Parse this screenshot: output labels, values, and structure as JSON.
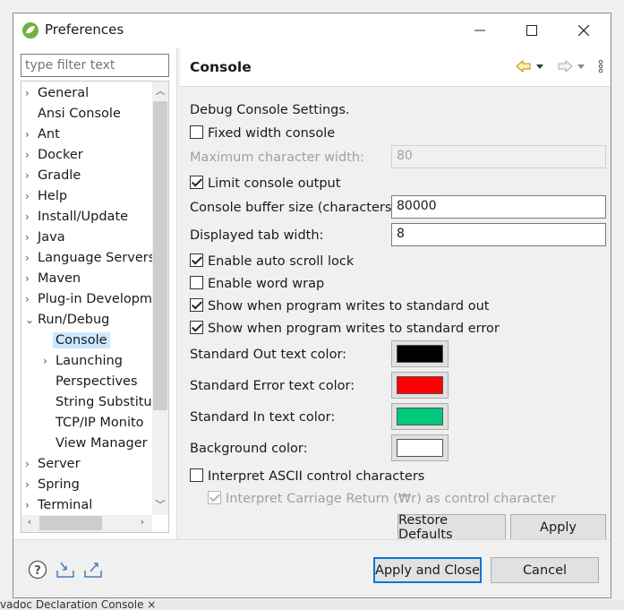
{
  "window": {
    "title": "Preferences",
    "minimize_icon": "minimize-icon",
    "maximize_icon": "maximize-icon",
    "close_icon": "close-icon"
  },
  "filter": {
    "placeholder": "type filter text"
  },
  "tree": {
    "items": [
      {
        "label": "General",
        "expandable": true
      },
      {
        "label": "Ansi Console",
        "expandable": false
      },
      {
        "label": "Ant",
        "expandable": true
      },
      {
        "label": "Docker",
        "expandable": true
      },
      {
        "label": "Gradle",
        "expandable": true
      },
      {
        "label": "Help",
        "expandable": true
      },
      {
        "label": "Install/Update",
        "expandable": true
      },
      {
        "label": "Java",
        "expandable": true
      },
      {
        "label": "Language Servers",
        "expandable": true
      },
      {
        "label": "Maven",
        "expandable": true
      },
      {
        "label": "Plug-in Developm",
        "expandable": true
      },
      {
        "label": "Run/Debug",
        "expandable": true,
        "expanded": true
      },
      {
        "label": "Console",
        "child": true,
        "selected": true
      },
      {
        "label": "Launching",
        "child": true,
        "expandable": true
      },
      {
        "label": "Perspectives",
        "child": true
      },
      {
        "label": "String Substitu",
        "child": true
      },
      {
        "label": "TCP/IP Monito",
        "child": true
      },
      {
        "label": "View Manager",
        "child": true
      },
      {
        "label": "Server",
        "expandable": true
      },
      {
        "label": "Spring",
        "expandable": true
      },
      {
        "label": "Terminal",
        "expandable": true
      }
    ]
  },
  "page": {
    "title": "Console",
    "description": "Debug Console Settings.",
    "fixed_width": {
      "label": "Fixed width console",
      "checked": false
    },
    "max_char_width": {
      "label": "Maximum character width:",
      "value": "80"
    },
    "limit_output": {
      "label": "Limit console output",
      "checked": true
    },
    "buffer_size": {
      "label": "Console buffer size (characters):",
      "value": "80000"
    },
    "tab_width": {
      "label": "Displayed tab width:",
      "value": "8"
    },
    "auto_scroll_lock": {
      "label": "Enable auto scroll lock",
      "checked": true
    },
    "word_wrap": {
      "label": "Enable word wrap",
      "checked": false
    },
    "show_stdout": {
      "label": "Show when program writes to standard out",
      "checked": true
    },
    "show_stderr": {
      "label": "Show when program writes to standard error",
      "checked": true
    },
    "stdout_color": {
      "label": "Standard Out text color:",
      "color": "#000000"
    },
    "stderr_color": {
      "label": "Standard Error text color:",
      "color": "#ff0000"
    },
    "stdin_color": {
      "label": "Standard In text color:",
      "color": "#00c87d"
    },
    "bg_color": {
      "label": "Background color:",
      "color": "#ffffff"
    },
    "interpret_ascii": {
      "label": "Interpret ASCII control characters",
      "checked": false
    },
    "interpret_cr": {
      "label": "Interpret Carriage Return (₩r) as control character",
      "checked": true
    }
  },
  "buttons": {
    "restore_defaults": "Restore Defaults",
    "apply": "Apply",
    "apply_and_close": "Apply and Close",
    "cancel": "Cancel"
  },
  "taskbar": {
    "text": "vadoc   Declaration   Console  ×"
  }
}
